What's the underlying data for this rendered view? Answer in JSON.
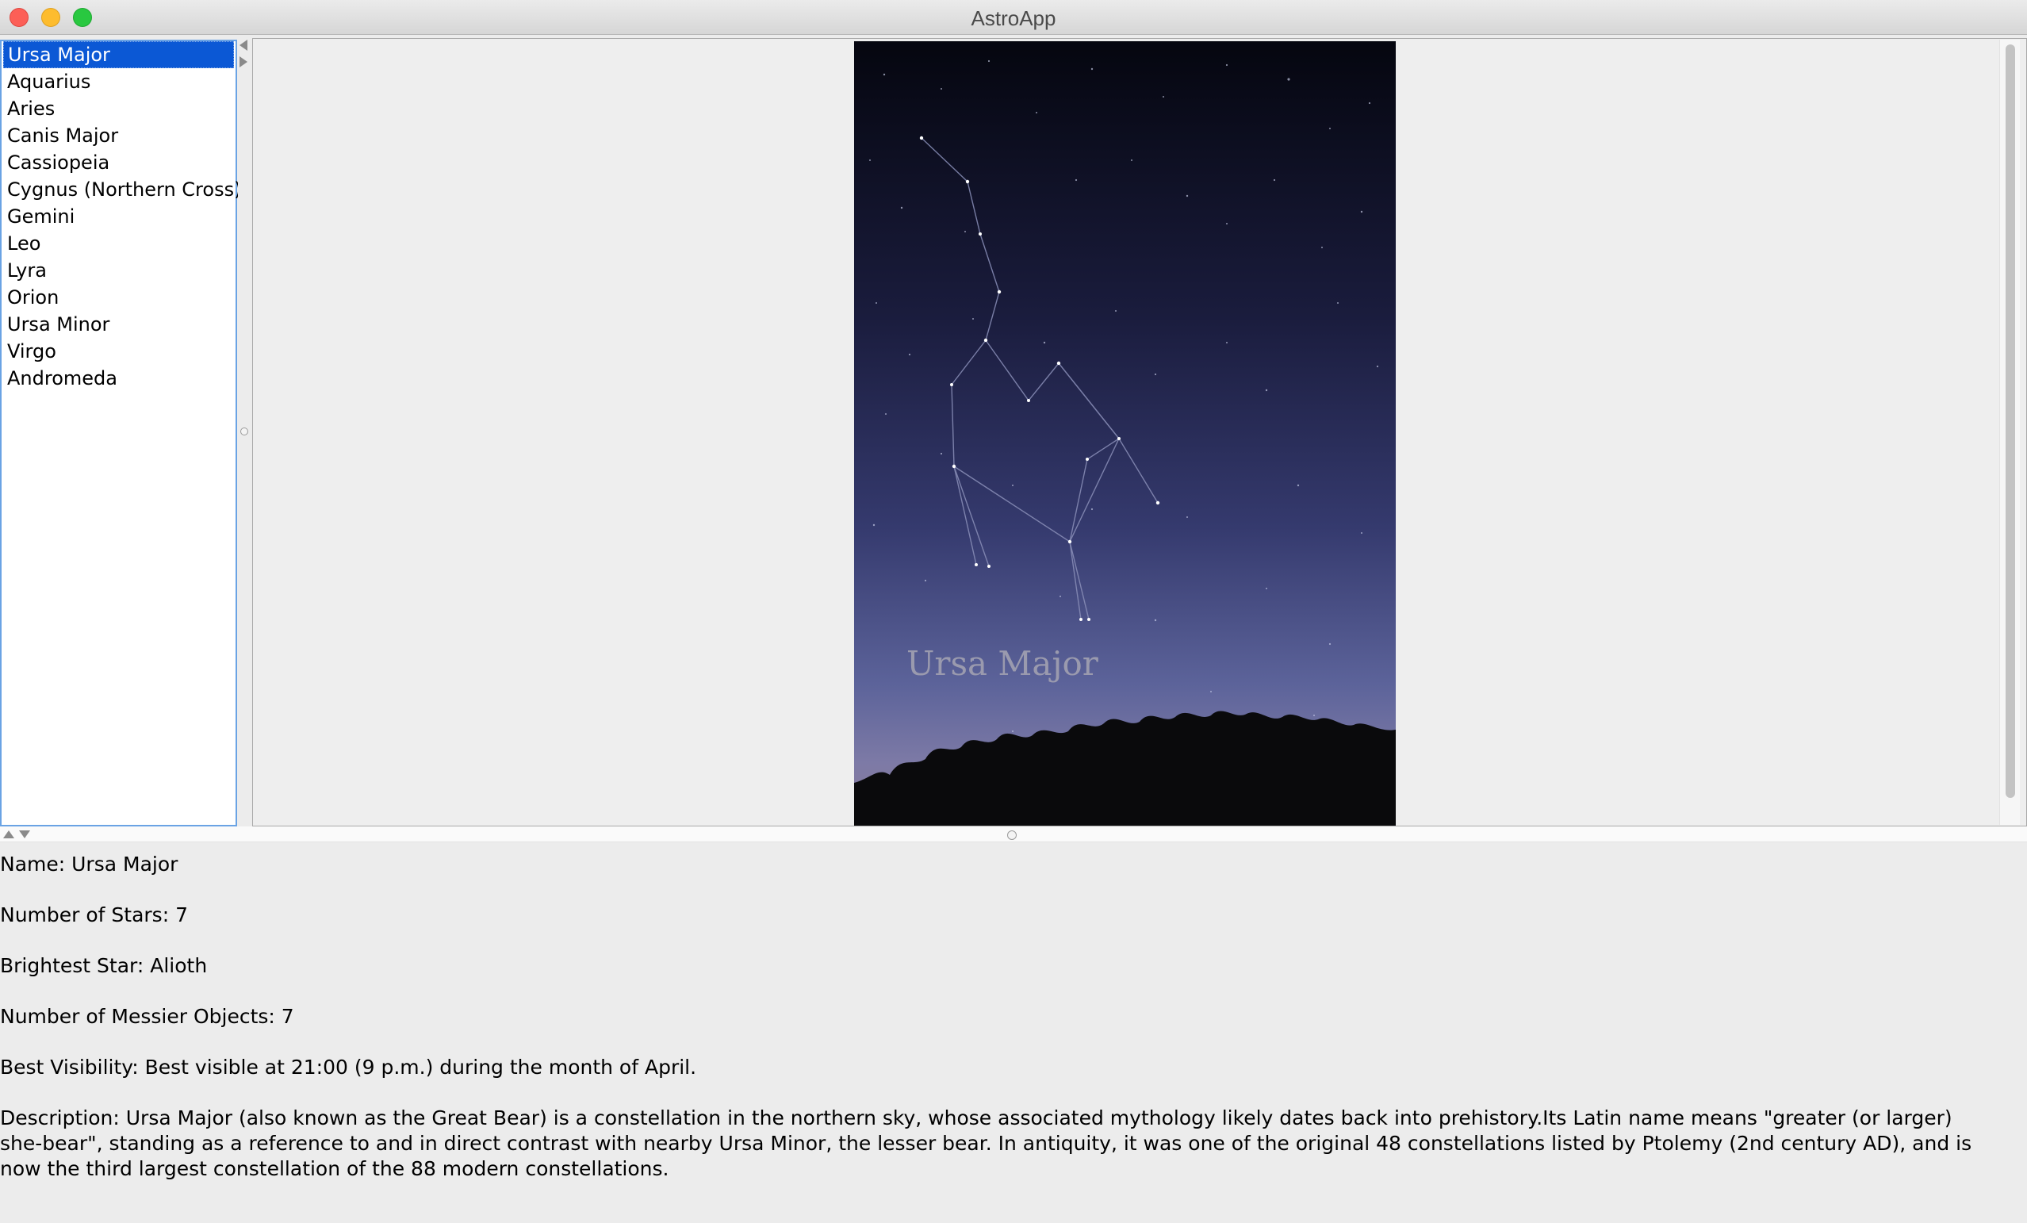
{
  "window": {
    "title": "AstroApp"
  },
  "constellations": {
    "items": [
      "Ursa Major",
      "Aquarius",
      "Aries",
      "Canis Major",
      "Cassiopeia",
      "Cygnus (Northern Cross)",
      "Gemini",
      "Leo",
      "Lyra",
      "Orion",
      "Ursa Minor",
      "Virgo",
      "Andromeda"
    ],
    "selected": "Ursa Major"
  },
  "image": {
    "overlay_label": "Ursa Major",
    "sky_top_color": "#05060f",
    "sky_bottom_color": "#6a72a6"
  },
  "details": {
    "name": "Name: Ursa Major",
    "stars": "Number of Stars: 7",
    "brightest": "Brightest Star: Alioth",
    "messier": "Number of Messier Objects: 7",
    "visibility": "Best Visibility: Best visible at 21:00 (9 p.m.) during the month of April.",
    "description": "Description: Ursa Major (also known as the Great Bear) is a constellation in the northern sky, whose associated mythology likely dates back into prehistory.Its Latin name means \"greater (or larger) she-bear\", standing as a reference to and in direct contrast with nearby Ursa Minor, the lesser bear. In antiquity, it was one of the original 48 constellations listed by Ptolemy (2nd century AD), and is now the third largest constellation of the 88 modern constellations."
  },
  "colors": {
    "selection": "#0b58d5",
    "list_focus_border": "#6aa3e4"
  }
}
